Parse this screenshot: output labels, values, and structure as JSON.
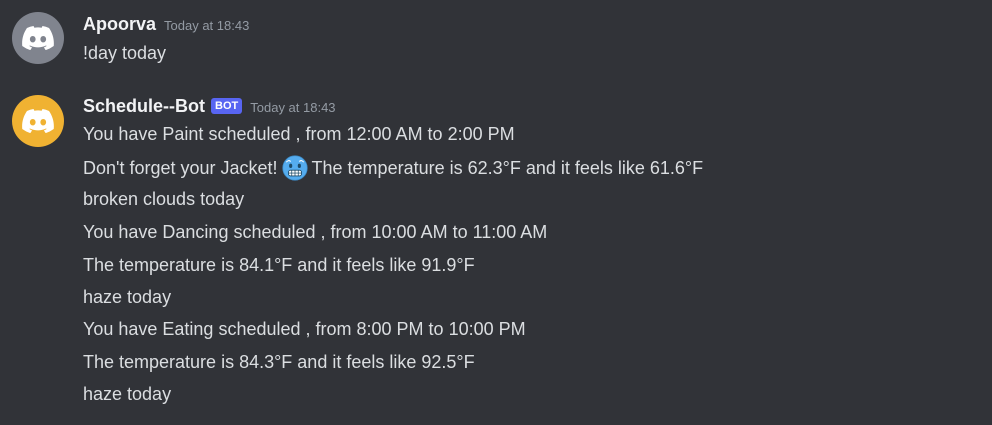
{
  "colors": {
    "background": "#313338",
    "username": "#f2f3f5",
    "text": "#dbdee1",
    "timestamp": "#949ba4",
    "bot_tag": "#5865f2",
    "avatar_user": "#80848e",
    "avatar_bot": "#f0b232"
  },
  "messages": [
    {
      "author": "Apoorva",
      "timestamp": "Today at 18:43",
      "avatar_icon": "discord-logo-icon",
      "lines": [
        "!day today"
      ]
    },
    {
      "author": "Schedule--Bot",
      "bot_tag": "BOT",
      "timestamp": "Today at 18:43",
      "avatar_icon": "discord-logo-icon",
      "lines": {
        "l1": "You have Paint scheduled , from 12:00 AM to 2:00 PM",
        "l2_a": "Don't forget your Jacket!",
        "l2_emoji": "cold-face-emoji",
        "l2_b": "The temperature is 62.3°F and it feels like 61.6°F",
        "l3": "broken clouds today",
        "l4": "You have Dancing scheduled , from 10:00 AM to 11:00 AM",
        "l5": "The temperature is 84.1°F and it feels like 91.9°F",
        "l6": "haze today",
        "l7": "You have Eating scheduled , from 8:00 PM to 10:00 PM",
        "l8": "The temperature is 84.3°F and it feels like 92.5°F",
        "l9": "haze today"
      }
    }
  ]
}
